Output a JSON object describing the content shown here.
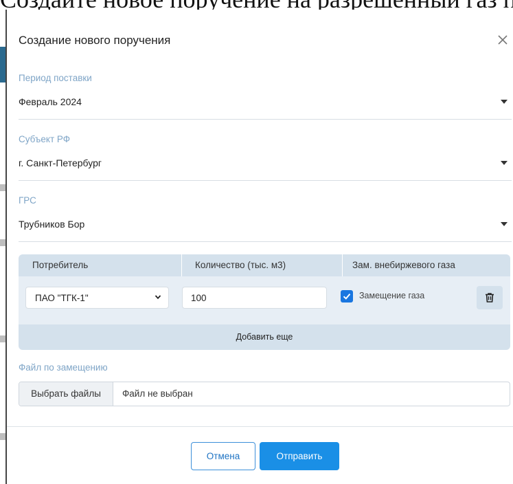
{
  "background": {
    "top_text": "Создайте новое поручение на разрешенный газ по субъекту"
  },
  "modal": {
    "title": "Создание нового поручения",
    "close_icon": "close-icon"
  },
  "fields": {
    "period": {
      "label": "Период поставки",
      "value": "Февраль 2024"
    },
    "region": {
      "label": "Субъект РФ",
      "value": "г. Санкт-Петербург"
    },
    "grs": {
      "label": "ГРС",
      "value": "Трубников Бор"
    }
  },
  "table": {
    "headers": [
      "Потребитель",
      "Количество (тыс. м3)",
      "Зам. внебиржевого газа"
    ],
    "rows": [
      {
        "consumer": "ПАО \"ТГК-1\"",
        "quantity": "100",
        "replacement_checked": true,
        "replacement_label": "Замещение газа",
        "delete_icon": "trash-icon"
      }
    ],
    "add_label": "Добавить еще"
  },
  "file": {
    "label": "Файл по замещению",
    "button_label": "Выбрать файлы",
    "status": "Файл не выбран"
  },
  "footer": {
    "cancel_label": "Отмена",
    "submit_label": "Отправить"
  },
  "colors": {
    "accent": "#1a8fe6",
    "label": "#7fa5c7",
    "table_header": "#d4e1ec"
  }
}
